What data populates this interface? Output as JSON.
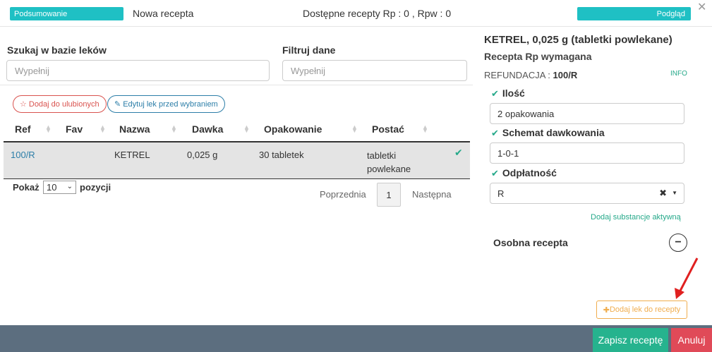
{
  "header": {
    "summary_label": "Podsumowanie",
    "title": "Nowa recepta",
    "available": "Dostępne recepty Rp : 0 , Rpw : 0",
    "preview_label": "Podgląd",
    "close_icon": "close-icon"
  },
  "search": {
    "label": "Szukaj w bazie leków",
    "placeholder": "Wypełnij"
  },
  "filter": {
    "label": "Filtruj dane",
    "placeholder": "Wypełnij"
  },
  "actions": {
    "favorite_label": "Dodaj do ulubionych",
    "edit_label": "Edytuj lek przed wybraniem"
  },
  "table": {
    "columns": [
      "Ref",
      "Fav",
      "Nazwa",
      "Dawka",
      "Opakowanie",
      "Postać"
    ],
    "rows": [
      {
        "ref": "100/R",
        "fav": "",
        "name": "KETREL",
        "dose": "0,025 g",
        "pack": "30 tabletek",
        "form": "tabletki powlekane",
        "selected": true
      }
    ]
  },
  "pagination": {
    "show_label": "Pokaż",
    "page_size": "10",
    "positions_label": "pozycji",
    "prev_label": "Poprzednia",
    "current_page": "1",
    "next_label": "Następna"
  },
  "detail": {
    "drug_title": "KETREL, 0,025 g (tabletki powlekane)",
    "rx_required": "Recepta Rp wymagana",
    "refund_label": "REFUNDACJA : ",
    "refund_value": "100/R",
    "info_label": "INFO",
    "qty_label": "Ilość",
    "qty_value": "2 opakowania",
    "schema_label": "Schemat dawkowania",
    "schema_value": "1-0-1",
    "pay_label": "Odpłatność",
    "pay_value": "R",
    "add_active_label": "Dodaj substancje aktywną",
    "separate_label": "Osobna recepta",
    "add_drug_label": "Dodaj lek do recepty"
  },
  "footer": {
    "save_label": "Zapisz receptę",
    "cancel_label": "Anuluj"
  },
  "colors": {
    "teal": "#1fc0c4",
    "green": "#26b38e",
    "red": "#e04a58",
    "footer_bg": "#5c6e7f",
    "orange": "#f0ad4e"
  }
}
